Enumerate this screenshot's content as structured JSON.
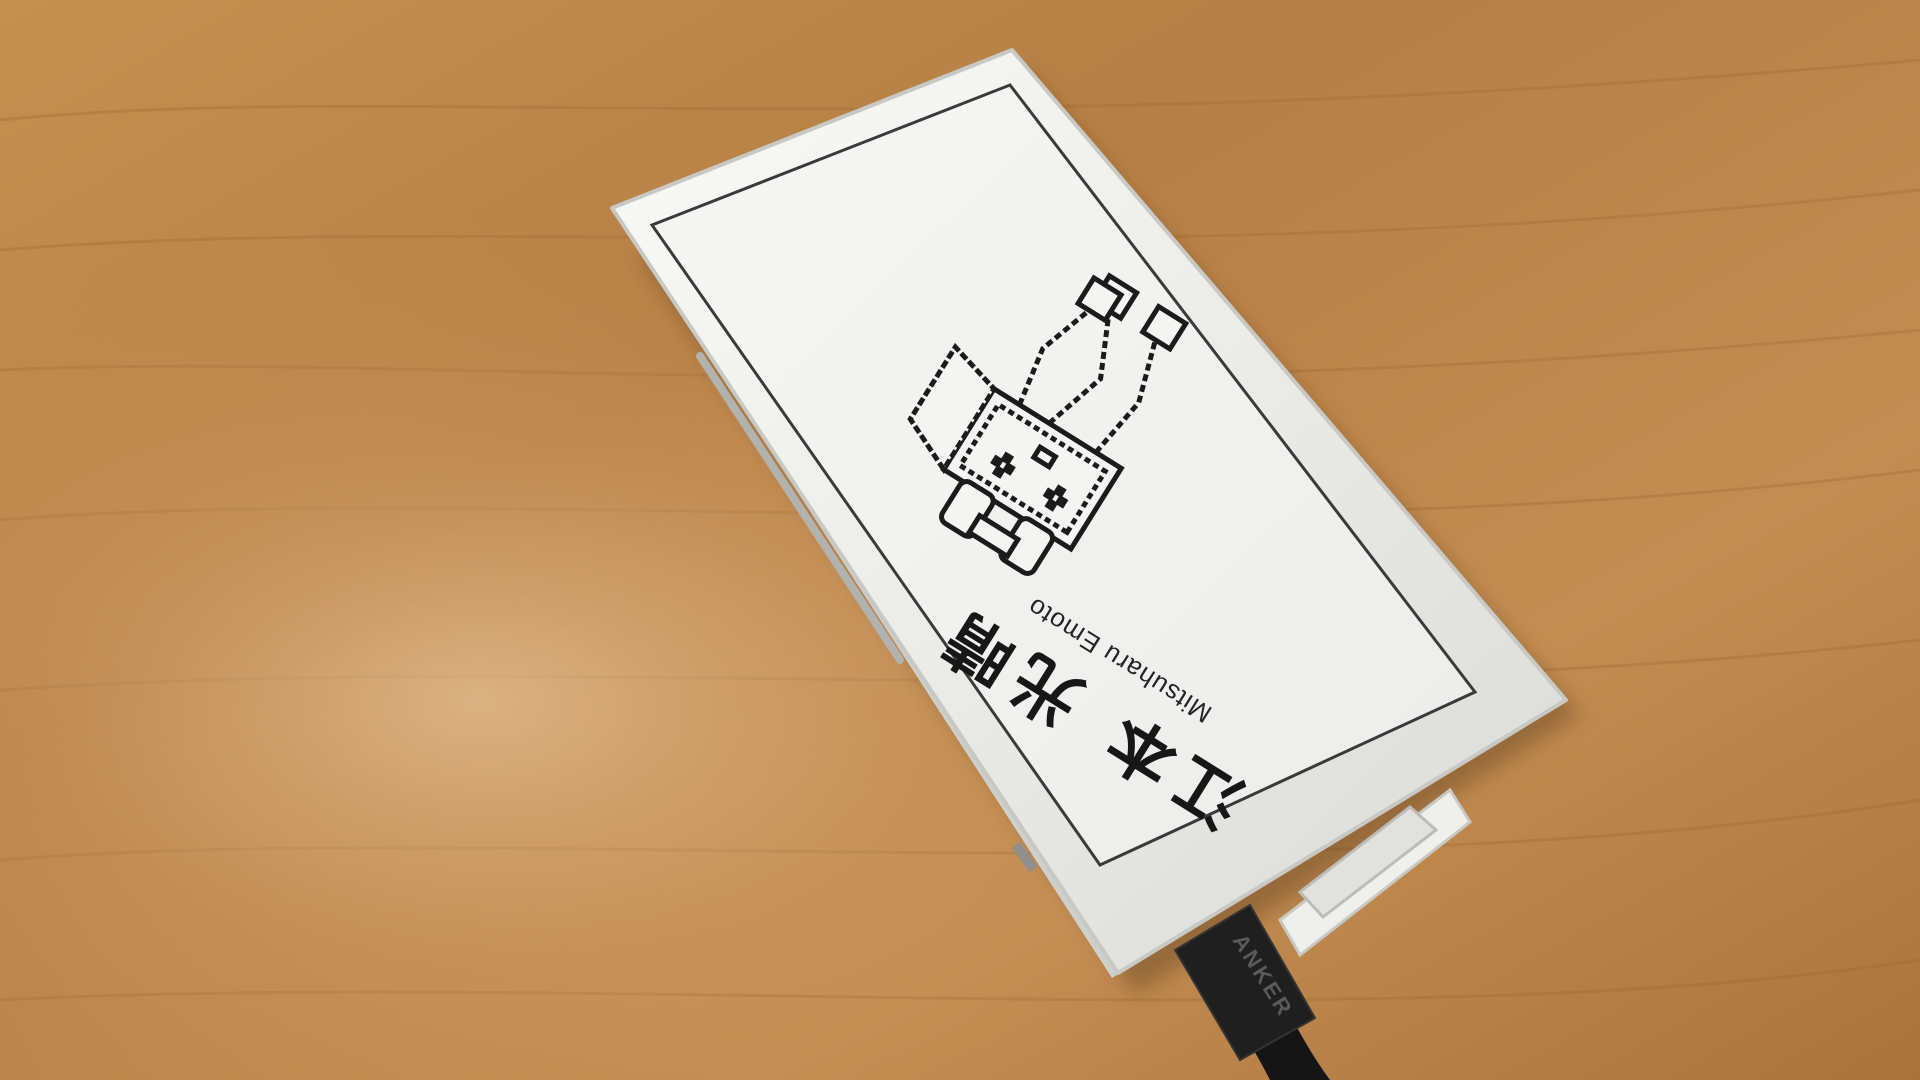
{
  "display": {
    "name_japanese": "江本 光晴",
    "name_romaji": "Mitsuharu Emoto"
  },
  "cable": {
    "brand": "ANKER"
  },
  "colors": {
    "desk_base": "#b9864a",
    "desk_grain": "#9f6b34",
    "device_body": "#ececea",
    "screen": "#f4f4f2",
    "ink": "#1b1b1b",
    "cable": "#151515"
  }
}
